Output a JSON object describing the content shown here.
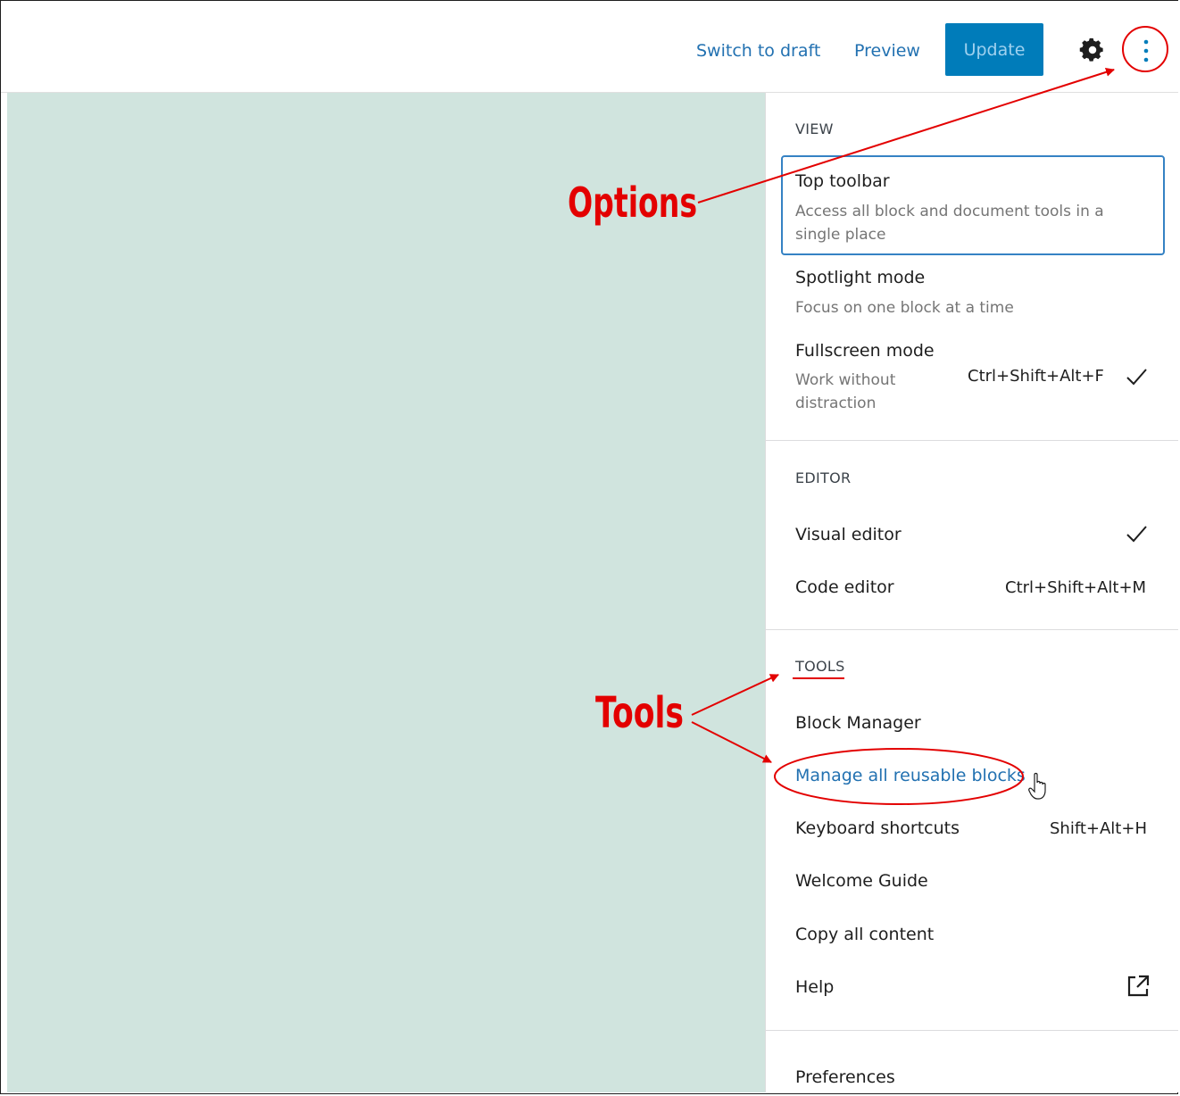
{
  "header": {
    "switch_to_draft": "Switch to draft",
    "preview": "Preview",
    "update": "Update",
    "settings_icon": "gear-icon",
    "options_icon": "vertical-ellipsis-icon"
  },
  "menu": {
    "view": {
      "title": "VIEW",
      "items": [
        {
          "label": "Top toolbar",
          "description": "Access all block and document tools in a single place",
          "description_line1": "Access all block and document tools in a",
          "description_line2": "single place"
        },
        {
          "label": "Spotlight mode",
          "description": "Focus on one block at a time"
        },
        {
          "label": "Fullscreen mode",
          "description_line1": "Work without",
          "description_line2": "distraction",
          "shortcut": "Ctrl+Shift+Alt+F",
          "checked": true
        }
      ]
    },
    "editor": {
      "title": "EDITOR",
      "items": [
        {
          "label": "Visual editor",
          "checked": true
        },
        {
          "label": "Code editor",
          "shortcut": "Ctrl+Shift+Alt+M"
        }
      ]
    },
    "tools": {
      "title": "TOOLS",
      "items": [
        {
          "label": "Block Manager"
        },
        {
          "label": "Manage all reusable blocks"
        },
        {
          "label": "Keyboard shortcuts",
          "shortcut": "Shift+Alt+H"
        },
        {
          "label": "Welcome Guide"
        },
        {
          "label": "Copy all content"
        },
        {
          "label": "Help",
          "icon": "external-link-icon"
        }
      ]
    },
    "preferences": {
      "label": "Preferences"
    }
  },
  "annotations": {
    "options": "Options",
    "tools": "Tools",
    "color": "#e30000"
  },
  "colors": {
    "accent": "#007cba",
    "link": "#2271b1",
    "canvas": "#d0e4de"
  }
}
